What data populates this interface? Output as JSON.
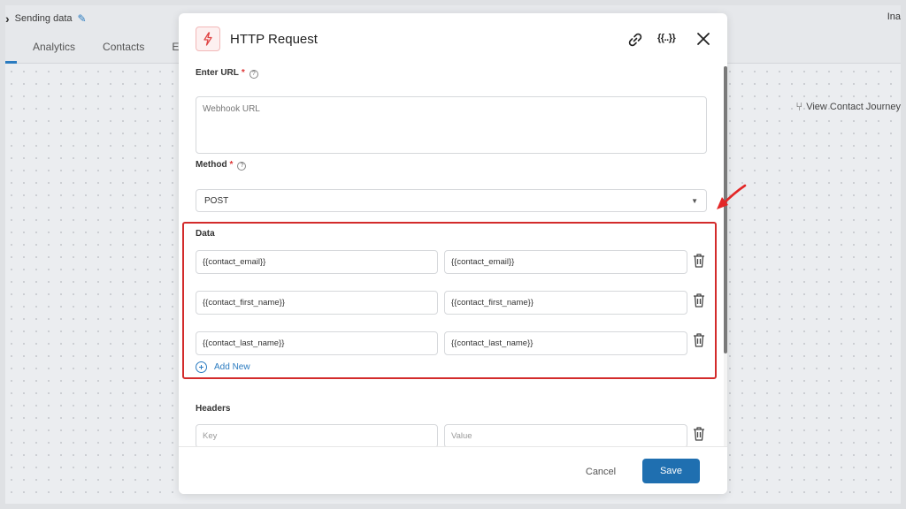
{
  "background": {
    "breadcrumb_current": "Sending data",
    "right_label": "Ina",
    "tabs": [
      {
        "label": "Analytics"
      },
      {
        "label": "Contacts"
      },
      {
        "label": "E"
      }
    ],
    "view_journey_label": "View Contact Journey"
  },
  "modal": {
    "title": "HTTP Request",
    "vars_label": "{{..}}",
    "url": {
      "label": "Enter URL",
      "required_mark": "*",
      "help_mark": "?",
      "placeholder": "Webhook URL",
      "value": ""
    },
    "method": {
      "label": "Method",
      "required_mark": "*",
      "help_mark": "?",
      "selected": "POST"
    },
    "data": {
      "label": "Data",
      "rows": [
        {
          "key": "{{contact_email}}",
          "value": "{{contact_email}}"
        },
        {
          "key": "{{contact_first_name}}",
          "value": "{{contact_first_name}}"
        },
        {
          "key": "{{contact_last_name}}",
          "value": "{{contact_last_name}}"
        }
      ],
      "add_label": "Add New"
    },
    "headers": {
      "label": "Headers",
      "key_placeholder": "Key",
      "value_placeholder": "Value"
    },
    "footer": {
      "cancel_label": "Cancel",
      "save_label": "Save"
    }
  },
  "colors": {
    "accent": "#1f6fb0",
    "highlight": "#d32b2b",
    "icon_red": "#e04545"
  }
}
